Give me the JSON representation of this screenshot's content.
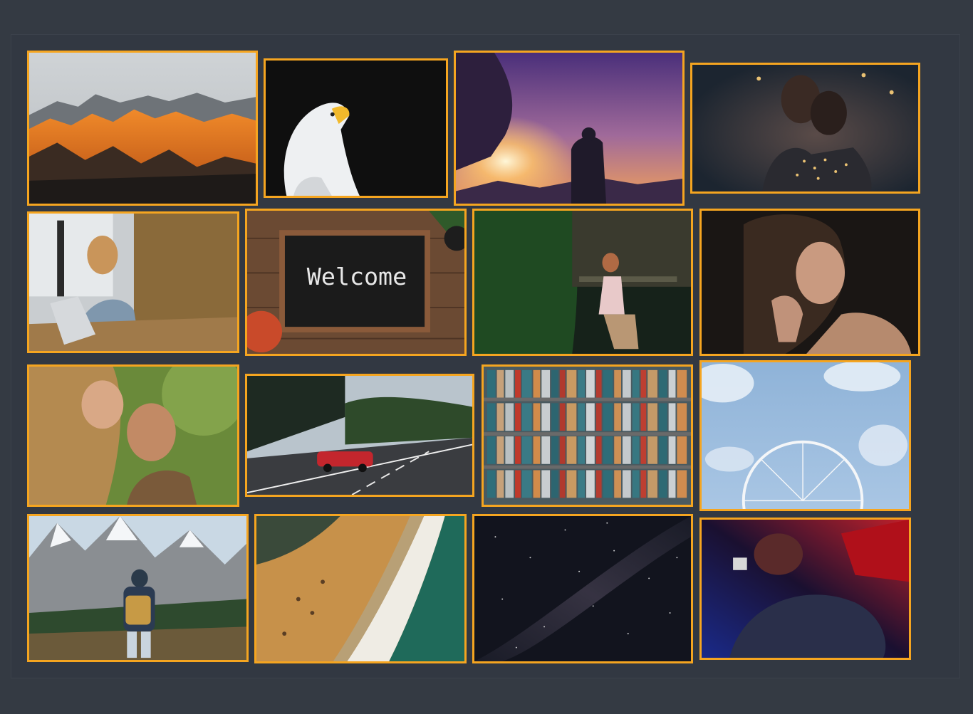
{
  "gallery": {
    "welcome_sign": "Welcome",
    "accent_color": "#f5a520",
    "background_color": "#343a43",
    "photos": [
      {
        "subject": "mountains-sunset"
      },
      {
        "subject": "bald-eagle"
      },
      {
        "subject": "hiker-sunset-purple"
      },
      {
        "subject": "two-women-fairy-lights"
      },
      {
        "subject": "office-laptop-meeting"
      },
      {
        "subject": "welcome-sign"
      },
      {
        "subject": "woman-garden-sitting"
      },
      {
        "subject": "woman-hair-portrait"
      },
      {
        "subject": "couple-smiling"
      },
      {
        "subject": "red-car-road"
      },
      {
        "subject": "bookshelf"
      },
      {
        "subject": "ferris-wheel-sky"
      },
      {
        "subject": "hiker-mountains"
      },
      {
        "subject": "beach-aerial"
      },
      {
        "subject": "milky-way"
      },
      {
        "subject": "red-blue-portrait"
      }
    ]
  }
}
